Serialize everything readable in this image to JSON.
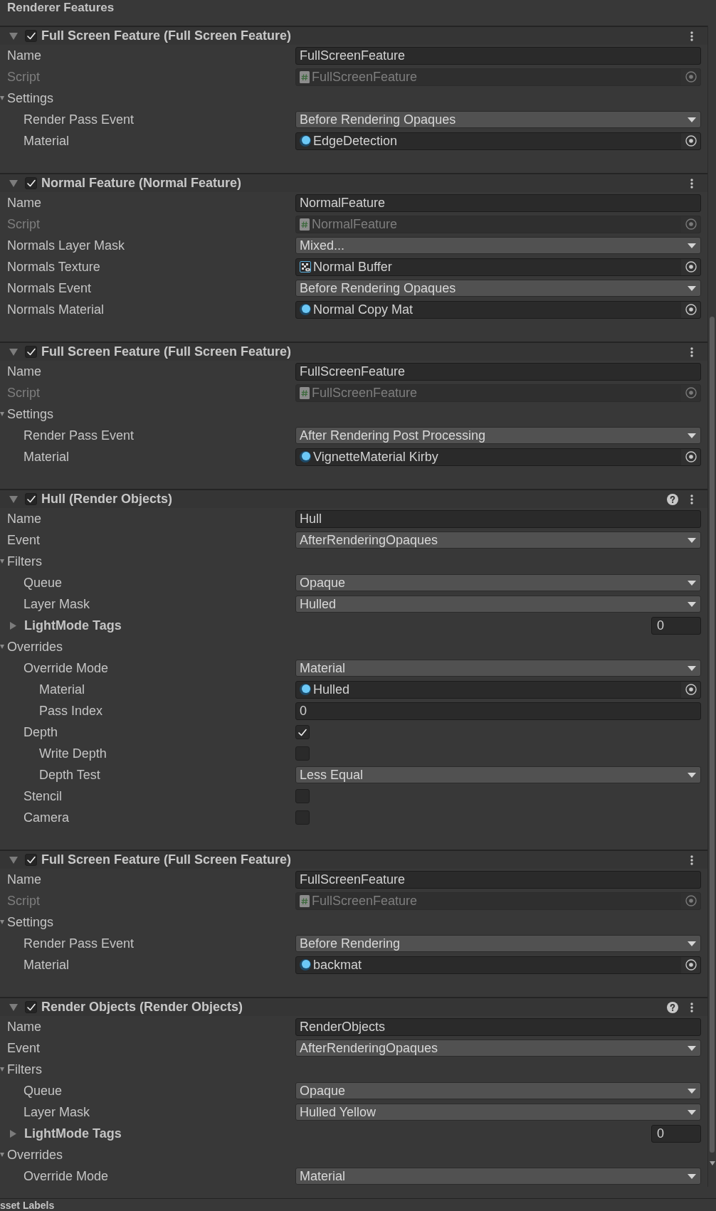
{
  "panel": {
    "title": "Renderer Features"
  },
  "features": [
    {
      "title": "Full Screen Feature (Full Screen Feature)",
      "enabled": true,
      "expanded": true,
      "has_help": false,
      "properties": [
        {
          "kind": "text",
          "label": "Name",
          "value": "FullScreenFeature"
        },
        {
          "kind": "script",
          "label": "Script",
          "value": "FullScreenFeature",
          "disabled": true
        },
        {
          "kind": "group",
          "label": "Settings",
          "expanded": true,
          "children": [
            {
              "kind": "dropdown",
              "label": "Render Pass Event",
              "value": "Before Rendering Opaques"
            },
            {
              "kind": "material",
              "label": "Material",
              "value": "EdgeDetection",
              "disabled": false
            }
          ]
        }
      ]
    },
    {
      "title": "Normal Feature (Normal Feature)",
      "enabled": true,
      "expanded": true,
      "has_help": false,
      "properties": [
        {
          "kind": "text",
          "label": "Name",
          "value": "NormalFeature"
        },
        {
          "kind": "script",
          "label": "Script",
          "value": "NormalFeature",
          "disabled": true
        },
        {
          "kind": "dropdown",
          "label": "Normals Layer Mask",
          "value": "Mixed..."
        },
        {
          "kind": "texture",
          "label": "Normals Texture",
          "value": "Normal Buffer",
          "disabled": false
        },
        {
          "kind": "dropdown",
          "label": "Normals Event",
          "value": "Before Rendering Opaques"
        },
        {
          "kind": "material",
          "label": "Normals Material",
          "value": "Normal Copy Mat",
          "disabled": false
        }
      ]
    },
    {
      "title": "Full Screen Feature (Full Screen Feature)",
      "enabled": true,
      "expanded": true,
      "has_help": false,
      "properties": [
        {
          "kind": "text",
          "label": "Name",
          "value": "FullScreenFeature"
        },
        {
          "kind": "script",
          "label": "Script",
          "value": "FullScreenFeature",
          "disabled": true
        },
        {
          "kind": "group",
          "label": "Settings",
          "expanded": true,
          "children": [
            {
              "kind": "dropdown",
              "label": "Render Pass Event",
              "value": "After Rendering Post Processing"
            },
            {
              "kind": "material",
              "label": "Material",
              "value": "VignetteMaterial Kirby",
              "disabled": false
            }
          ]
        }
      ]
    },
    {
      "title": "Hull (Render Objects)",
      "enabled": true,
      "expanded": true,
      "has_help": true,
      "properties": [
        {
          "kind": "text",
          "label": "Name",
          "value": "Hull"
        },
        {
          "kind": "dropdown",
          "label": "Event",
          "value": "AfterRenderingOpaques"
        },
        {
          "kind": "group",
          "label": "Filters",
          "expanded": true,
          "children": [
            {
              "kind": "dropdown",
              "label": "Queue",
              "value": "Opaque"
            },
            {
              "kind": "dropdown",
              "label": "Layer Mask",
              "value": "Hulled"
            },
            {
              "kind": "tags",
              "label": "LightMode Tags",
              "value": "0",
              "expanded": false
            }
          ]
        },
        {
          "kind": "group",
          "label": "Overrides",
          "expanded": true,
          "children": [
            {
              "kind": "dropdown",
              "label": "Override Mode",
              "value": "Material",
              "children": [
                {
                  "kind": "material",
                  "label": "Material",
                  "value": "Hulled",
                  "disabled": false
                },
                {
                  "kind": "text",
                  "label": "Pass Index",
                  "value": "0"
                }
              ]
            },
            {
              "kind": "checkbox",
              "label": "Depth",
              "checked": true,
              "children": [
                {
                  "kind": "checkbox",
                  "label": "Write Depth",
                  "checked": false
                },
                {
                  "kind": "dropdown",
                  "label": "Depth Test",
                  "value": "Less Equal"
                }
              ]
            },
            {
              "kind": "checkbox",
              "label": "Stencil",
              "checked": false
            },
            {
              "kind": "checkbox",
              "label": "Camera",
              "checked": false
            }
          ]
        }
      ]
    },
    {
      "title": "Full Screen Feature (Full Screen Feature)",
      "enabled": true,
      "expanded": true,
      "has_help": false,
      "properties": [
        {
          "kind": "text",
          "label": "Name",
          "value": "FullScreenFeature"
        },
        {
          "kind": "script",
          "label": "Script",
          "value": "FullScreenFeature",
          "disabled": true
        },
        {
          "kind": "group",
          "label": "Settings",
          "expanded": true,
          "children": [
            {
              "kind": "dropdown",
              "label": "Render Pass Event",
              "value": "Before Rendering"
            },
            {
              "kind": "material",
              "label": "Material",
              "value": "backmat",
              "disabled": false
            }
          ]
        }
      ]
    },
    {
      "title": "Render Objects (Render Objects)",
      "enabled": true,
      "expanded": true,
      "has_help": true,
      "properties": [
        {
          "kind": "text",
          "label": "Name",
          "value": "RenderObjects"
        },
        {
          "kind": "dropdown",
          "label": "Event",
          "value": "AfterRenderingOpaques"
        },
        {
          "kind": "group",
          "label": "Filters",
          "expanded": true,
          "children": [
            {
              "kind": "dropdown",
              "label": "Queue",
              "value": "Opaque"
            },
            {
              "kind": "dropdown",
              "label": "Layer Mask",
              "value": "Hulled Yellow"
            },
            {
              "kind": "tags",
              "label": "LightMode Tags",
              "value": "0",
              "expanded": false
            }
          ]
        },
        {
          "kind": "group",
          "label": "Overrides",
          "expanded": true,
          "children": [
            {
              "kind": "dropdown",
              "label": "Override Mode",
              "value": "Material"
            }
          ]
        }
      ]
    }
  ],
  "footer": {
    "title": "sset Labels"
  }
}
